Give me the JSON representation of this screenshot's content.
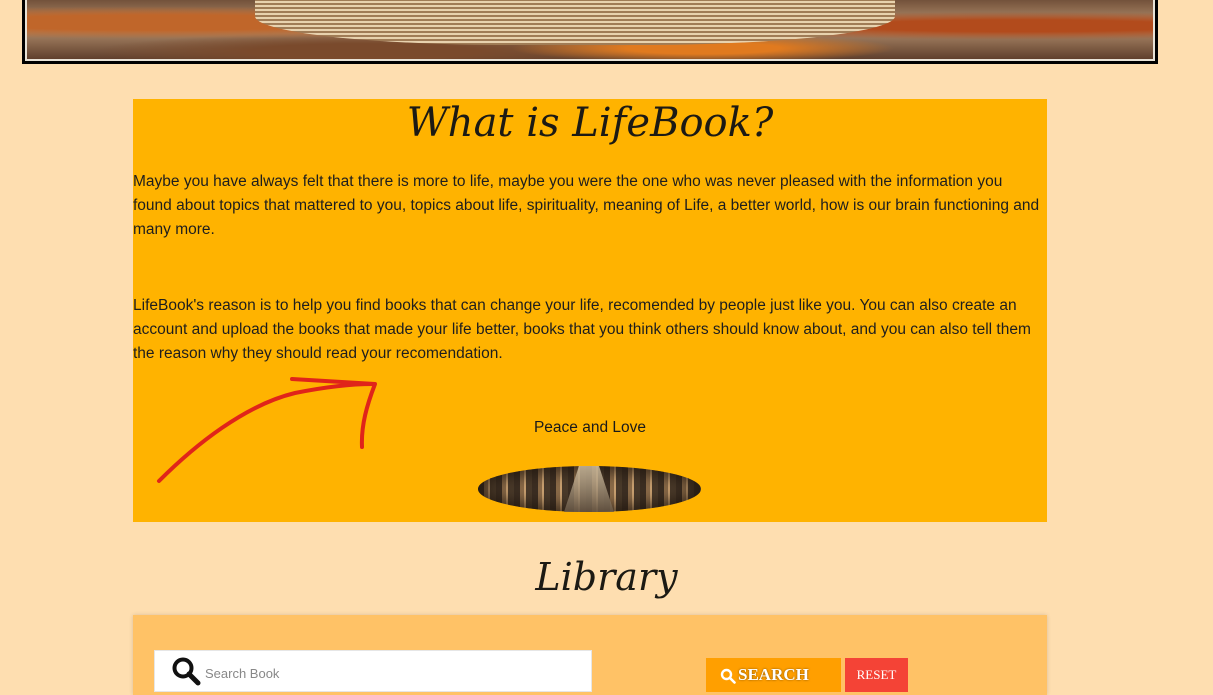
{
  "about": {
    "title": "What is LifeBook?",
    "paragraph1": "Maybe you have always felt that there is more to life, maybe you were the one who was never pleased with the information you found about topics that mattered to you, topics about life, spirituality, meaning of Life, a better world, how is our brain functioning and many more.",
    "paragraph2": "LifeBook's reason is to help you find books that can change your life, recomended by people just like you. You can also create an account and upload the books that made your life better, books that you think others should know about, and you can also tell them the reason why they should read your recomendation.",
    "signoff": "Peace and Love"
  },
  "library": {
    "title": "Library",
    "search_placeholder": "Search Book",
    "search_label": "SEARCH",
    "reset_label": "RESET"
  },
  "colors": {
    "page_bg": "#fedeb0",
    "about_bg": "#ffb300",
    "panel_bg": "#ffc266",
    "search_btn": "#ff9f00",
    "reset_btn": "#f44336",
    "annotation_arrow": "#e0241a"
  }
}
